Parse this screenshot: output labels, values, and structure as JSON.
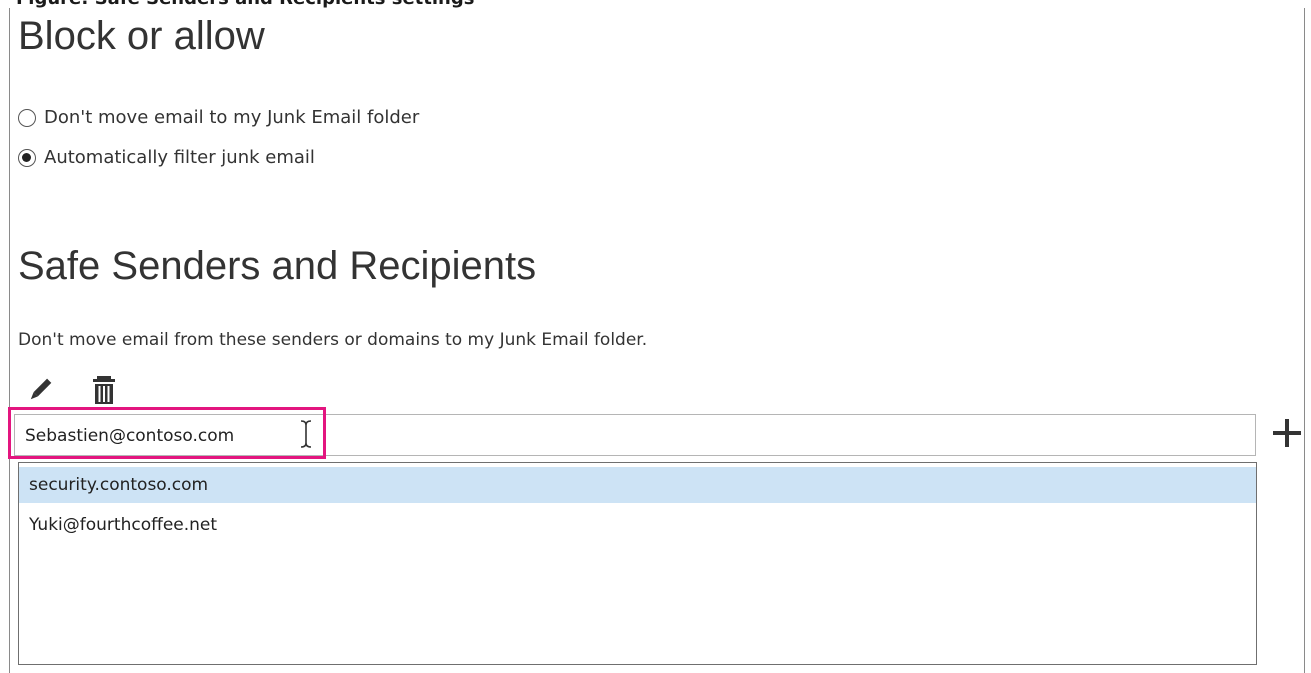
{
  "caption": "Figure: Safe Senders and Recipients settings",
  "block_section": {
    "title": "Block or allow",
    "options": [
      {
        "label": "Don't move email to my Junk Email folder",
        "selected": false
      },
      {
        "label": "Automatically filter junk email",
        "selected": true
      }
    ]
  },
  "safe_section": {
    "title": "Safe Senders and Recipients",
    "description": "Don't move email from these senders or domains to my Junk Email folder.",
    "entry_value": "Sebastien@contoso.com",
    "list": [
      {
        "address": "security.contoso.com",
        "selected": true
      },
      {
        "address": "Yuki@fourthcoffee.net",
        "selected": false
      }
    ]
  },
  "icons": {
    "edit": "pencil-icon",
    "delete": "trash-icon",
    "add": "plus-icon",
    "cursor": "text-cursor-icon"
  },
  "colors": {
    "highlight": "#e3157f",
    "selection": "#cde3f5"
  }
}
